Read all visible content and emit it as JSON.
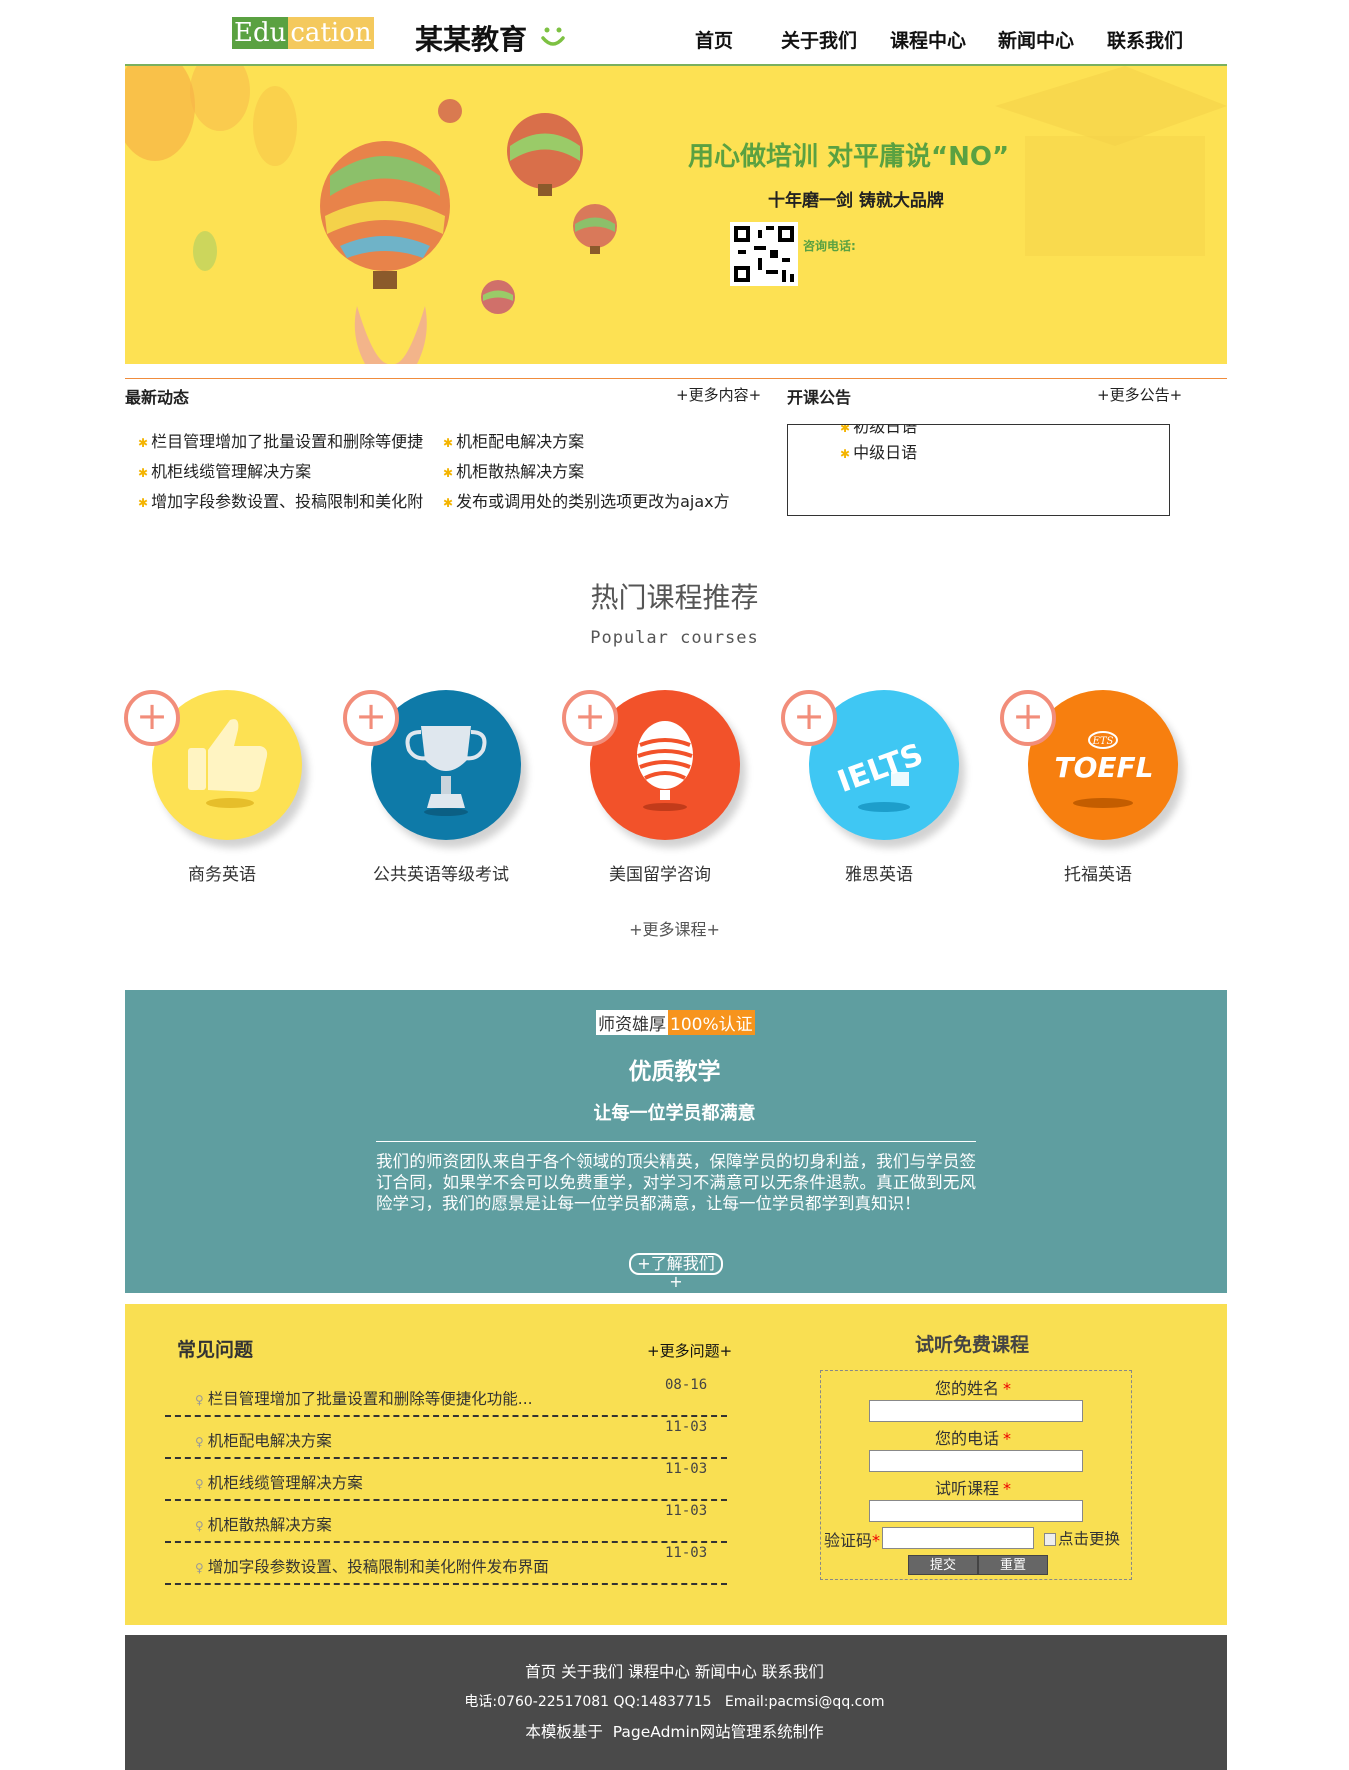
{
  "header": {
    "logo_part1": "Edu",
    "logo_part2": "cation",
    "brand": "某某教育",
    "nav": [
      "首页",
      "关于我们",
      "课程中心",
      "新闻中心",
      "联系我们"
    ]
  },
  "banner": {
    "title": "用心做培训 对平庸说“NO”",
    "subtitle": "十年磨一剑 铸就大品牌",
    "consult": "咨询电话:"
  },
  "news": {
    "title": "最新动态",
    "more": "+更多内容+",
    "items": [
      "栏目管理增加了批量设置和删除等便捷",
      "机柜配电解决方案",
      "机柜线缆管理解决方案",
      "机柜散热解决方案",
      "增加字段参数设置、投稿限制和美化附",
      "发布或调用处的类别选项更改为ajax方"
    ]
  },
  "notice": {
    "title": "开课公告",
    "more": "+更多公告+",
    "items": [
      "初级日语",
      "中级日语"
    ]
  },
  "courses": {
    "title": "热门课程推荐",
    "subtitle": "Popular courses",
    "items": [
      {
        "name": "商务英语",
        "color": "#fde153",
        "icon": "thumbs-up-icon"
      },
      {
        "name": "公共英语等级考试",
        "color": "#0e7aa8",
        "icon": "trophy-icon"
      },
      {
        "name": "美国留学咨询",
        "color": "#f2522a",
        "icon": "balloon-icon"
      },
      {
        "name": "雅思英语",
        "color": "#3fc7f3",
        "icon": "ielts-icon",
        "icon_text": "IELTS"
      },
      {
        "name": "托福英语",
        "color": "#f77f0f",
        "icon": "toefl-icon",
        "icon_text": "TOEFL",
        "icon_badge": "ETS"
      }
    ],
    "more": "+更多课程+"
  },
  "teaching": {
    "badge_a": "师资雄厚",
    "badge_b": "100%认证",
    "title": "优质教学",
    "subtitle": "让每一位学员都满意",
    "text": "我们的师资团队来自于各个领域的顶尖精英，保障学员的切身利益，我们与学员签订合同，如果学不会可以免费重学，对学习不满意可以无条件退款。真正做到无风险学习，我们的愿景是让每一位学员都满意，让每一位学员都学到真知识！",
    "button": "+了解我们+"
  },
  "faq": {
    "title": "常见问题",
    "more": "+更多问题+",
    "items": [
      {
        "q": "栏目管理增加了批量设置和删除等便捷化功能...",
        "d": "08-16"
      },
      {
        "q": "机柜配电解决方案",
        "d": "11-03"
      },
      {
        "q": "机柜线缆管理解决方案",
        "d": "11-03"
      },
      {
        "q": "机柜散热解决方案",
        "d": "11-03"
      },
      {
        "q": "增加字段参数设置、投稿限制和美化附件发布界面",
        "d": "11-03"
      }
    ]
  },
  "trial": {
    "title": "试听免费课程",
    "name_label": "您的姓名",
    "phone_label": "您的电话",
    "course_label": "试听课程",
    "captcha_label": "验证码",
    "required": "*",
    "captcha_alt": "点击更换",
    "submit": "提交",
    "reset": "重置"
  },
  "footer": {
    "links": "首页 关于我们 课程中心 新闻中心 联系我们",
    "contact": "电话:0760-22517081 QQ:14837715   Email:pacmsi@qq.com",
    "credit": "本模板基于  PageAdmin网站管理系统制作"
  },
  "colors": {
    "banner_bg": "#fde153",
    "teach_bg": "#5f9ea0",
    "faq_bg": "#f9df52",
    "footer_bg": "#4a4a4a",
    "accent_green": "#5aa141"
  }
}
